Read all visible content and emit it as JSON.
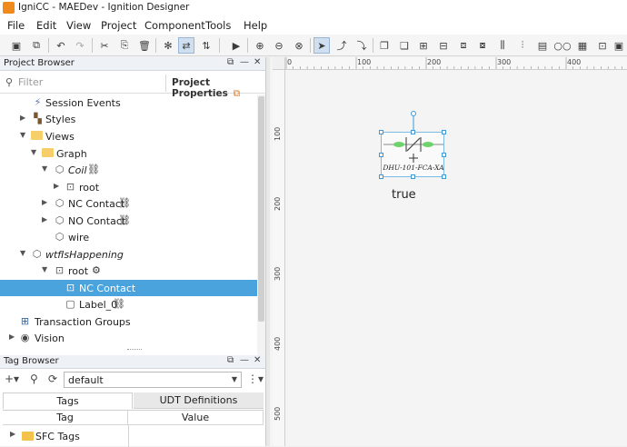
{
  "window": {
    "title": "IgniCC - MAEDev - Ignition Designer"
  },
  "menu": [
    "File",
    "Edit",
    "View",
    "Project",
    "Component",
    "Tools",
    "Help"
  ],
  "project_browser": {
    "title": "Project Browser",
    "search_placeholder": "Filter",
    "properties_button": "Project Properties",
    "tree": [
      {
        "label": "Session Events",
        "icon": "event-icon"
      },
      {
        "label": "Styles",
        "icon": "styles-icon"
      },
      {
        "label": "Views",
        "icon": "folder-icon"
      },
      {
        "label": "Graph",
        "icon": "folder-icon"
      },
      {
        "label": "Coil",
        "icon": "view-icon"
      },
      {
        "label": "root",
        "icon": "container-icon"
      },
      {
        "label": "NC Contact",
        "icon": "view-icon"
      },
      {
        "label": "NO Contact",
        "icon": "view-icon"
      },
      {
        "label": "wire",
        "icon": "view-icon"
      },
      {
        "label": "wtfIsHappening",
        "icon": "view-icon"
      },
      {
        "label": "root",
        "icon": "container-icon"
      },
      {
        "label": "NC Contact",
        "icon": "embedded-view-icon"
      },
      {
        "label": "Label_0",
        "icon": "label-icon"
      },
      {
        "label": "Transaction Groups",
        "icon": "transaction-icon"
      },
      {
        "label": "Vision",
        "icon": "vision-icon"
      }
    ]
  },
  "tag_browser": {
    "title": "Tag Browser",
    "provider": "default",
    "tabs": [
      "Tags",
      "UDT Definitions"
    ],
    "columns": [
      "Tag",
      "Value"
    ],
    "rows": [
      {
        "label": "SFC Tags"
      }
    ]
  },
  "designer": {
    "hruler_labels": [
      "0",
      "100",
      "200",
      "300",
      "400"
    ],
    "vruler_labels": [
      "100",
      "200",
      "300",
      "400",
      "500"
    ],
    "component_label": "DHU-101-FCA-XA",
    "value_text": "true",
    "accent": "#4aa3dd",
    "contact_color": "#6ed36a"
  }
}
